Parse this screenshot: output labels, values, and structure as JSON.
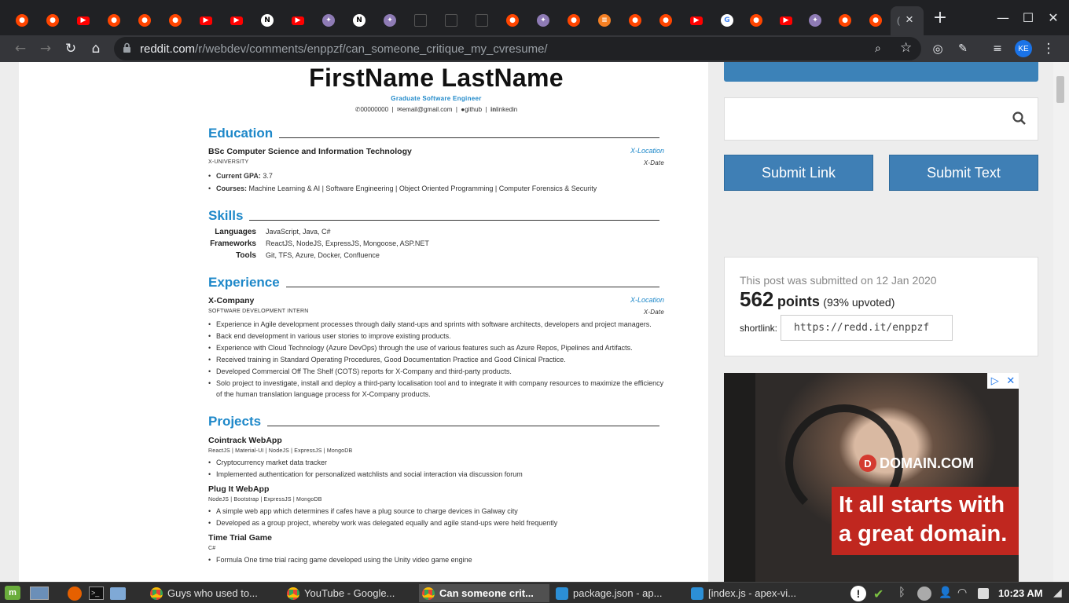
{
  "browser": {
    "url_host": "reddit.com",
    "url_path": "/r/webdev/comments/enppzf/can_someone_critique_my_cvresume/",
    "new_tab": "+",
    "close_tab": "×",
    "icons": [
      "back-arrow-icon",
      "forward-arrow-icon",
      "reload-icon",
      "home-icon",
      "lock-icon",
      "zoom-icon",
      "star-icon",
      "extension-icon",
      "profile-avatar",
      "menu-icon"
    ],
    "profile_initials": "KE",
    "tab_favicons": [
      "reddit",
      "reddit",
      "youtube",
      "reddit",
      "reddit",
      "reddit",
      "youtube",
      "youtube",
      "notion",
      "youtube",
      "other",
      "notion",
      "other",
      "blank",
      "blank",
      "blank",
      "reddit",
      "other",
      "reddit",
      "stackoverflow",
      "reddit",
      "reddit",
      "youtube",
      "google",
      "reddit",
      "youtube",
      "other",
      "reddit",
      "reddit"
    ]
  },
  "resume": {
    "name": "FirstName LastName",
    "subtitle": "Graduate Software Engineer",
    "contact_phone": "00000000",
    "contact_email": "email@gmail.com",
    "contact_github": "github",
    "contact_linkedin": "linkedin",
    "sections": {
      "education": "Education",
      "skills": "Skills",
      "experience": "Experience",
      "projects": "Projects"
    },
    "education": {
      "degree": "BSc Computer Science and Information Technology",
      "location": "X-Location",
      "school": "X-University",
      "date": "X-Date",
      "gpa_label": "Current GPA:",
      "gpa": "3.7",
      "courses_label": "Courses:",
      "courses": "Machine Learning & AI | Software Engineering | Object Oriented Programming | Computer Forensics & Security"
    },
    "skills": [
      {
        "k": "Languages",
        "v": "JavaScript, Java, C#"
      },
      {
        "k": "Frameworks",
        "v": "ReactJS, NodeJS, ExpressJS, Mongoose, ASP.NET"
      },
      {
        "k": "Tools",
        "v": "Git, TFS, Azure, Docker, Confluence"
      }
    ],
    "experience": {
      "company": "X-Company",
      "location": "X-Location",
      "role": "Software Development Intern",
      "date": "X-Date",
      "bullets": [
        "Experience in Agile development processes through daily stand-ups and sprints with software architects, developers and project managers.",
        "Back end development in various user stories to improve existing products.",
        "Experience with Cloud Technology (Azure DevOps) through the use of various features such as Azure Repos, Pipelines and Artifacts.",
        "Received training in Standard Operating Procedures, Good Documentation Practice and Good Clinical Practice.",
        "Developed Commercial Off The Shelf (COTS) reports for X-Company and third-party products.",
        "Solo project to investigate, install and deploy a third-party localisation tool and to integrate it with company resources to maximize the efficiency of the human translation language process for X-Company products."
      ]
    },
    "projects": [
      {
        "title": "Cointrack WebApp",
        "tags": "ReactJS | Material-UI | NodeJS | ExpressJS | MongoDB",
        "bullets": [
          "Cryptocurrency market data tracker",
          "Implemented authentication for personalized watchlists and social interaction via discussion forum"
        ]
      },
      {
        "title": "Plug It WebApp",
        "tags": "NodeJS | Bootstrap | ExpressJS | MongoDB",
        "bullets": [
          "A simple web app which determines if cafes have a plug source to charge devices in Galway city",
          "Developed as a group project, whereby work was delegated equally and agile stand-ups were held frequently"
        ]
      },
      {
        "title": "Time Trial Game",
        "tags": "C#",
        "bullets": [
          "Formula One time trial racing game developed using the Unity video game engine"
        ]
      }
    ]
  },
  "sidebar": {
    "submit_link": "Submit Link",
    "submit_text": "Submit Text",
    "submitted_text": "This post was submitted on 12 Jan 2020",
    "points": "562",
    "points_label": "points",
    "upvoted": "(93% upvoted)",
    "shortlink_label": "shortlink:",
    "shortlink": "https://redd.it/enppzf",
    "ad": {
      "brand": "DOMAIN.COM",
      "headline": "It all starts with a great domain."
    }
  },
  "taskbar": {
    "tasks": [
      {
        "label": "Guys who used to...",
        "app": "chrome"
      },
      {
        "label": "YouTube - Google...",
        "app": "chrome"
      },
      {
        "label": "Can someone crit...",
        "app": "chrome"
      },
      {
        "label": "package.json - ap...",
        "app": "vscode"
      },
      {
        "label": "[index.js - apex-vi...",
        "app": "vscode"
      }
    ],
    "clock": "10:23 AM"
  },
  "colors": {
    "reddit": "#ff4500",
    "youtube": "#ff0000",
    "resume_accent": "#1e88c9",
    "sidebar_button": "#3f7fb5"
  }
}
